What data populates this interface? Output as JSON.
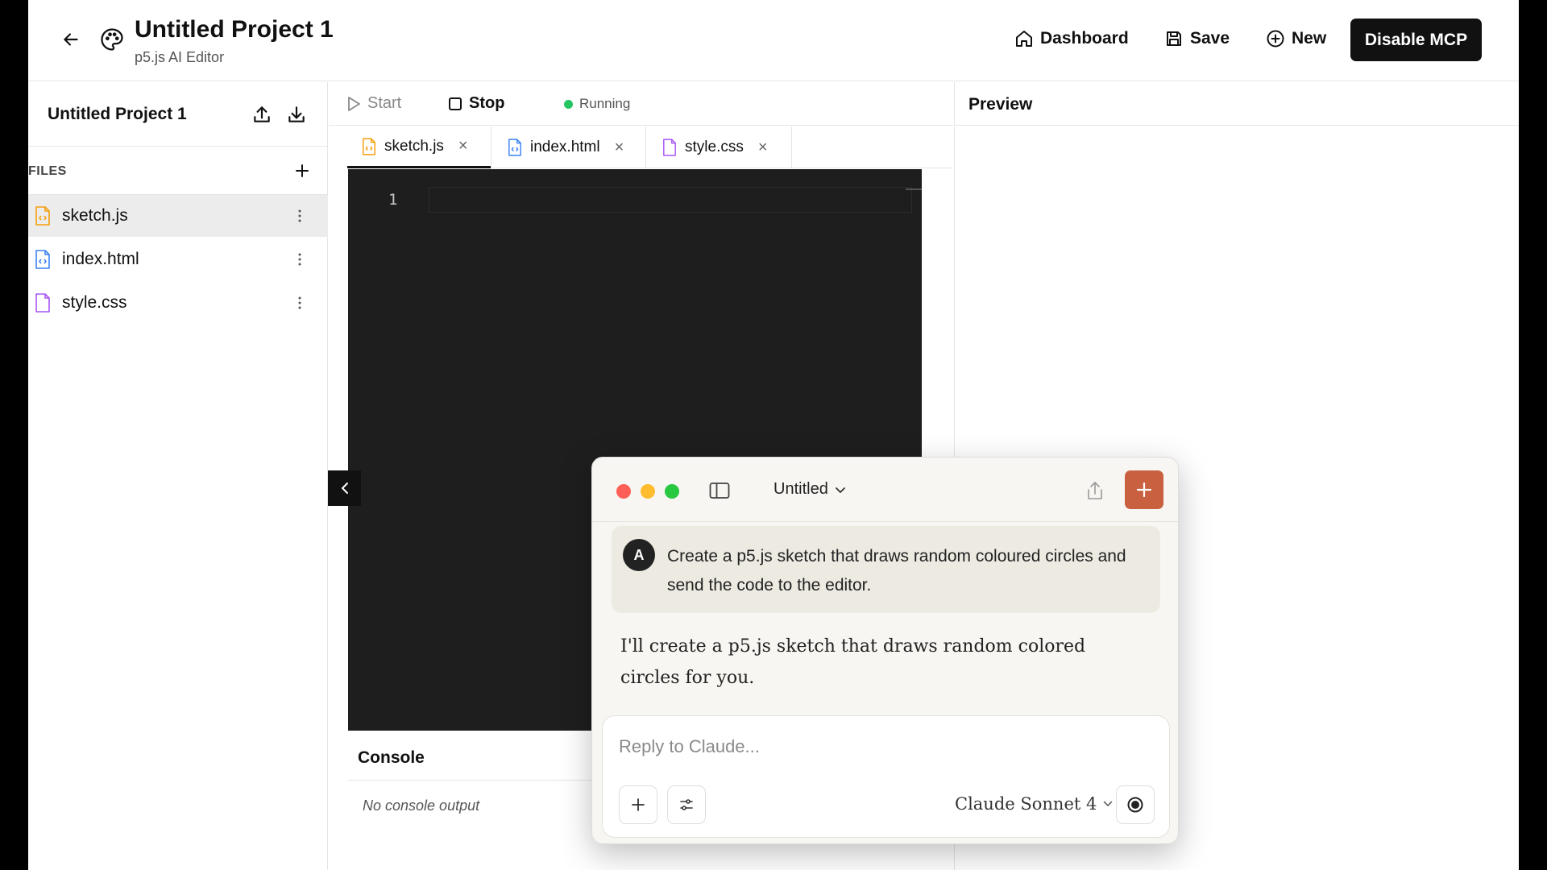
{
  "header": {
    "project_title": "Untitled Project 1",
    "subtitle": "p5.js AI Editor",
    "dashboard_label": "Dashboard",
    "save_label": "Save",
    "new_label": "New",
    "mcp_label": "Disable MCP"
  },
  "sidebar": {
    "title": "Untitled Project 1",
    "files_label": "FILES",
    "files": [
      {
        "name": "sketch.js",
        "icon": "js-file-icon",
        "color": "#f59e0b",
        "active": true
      },
      {
        "name": "index.html",
        "icon": "html-file-icon",
        "color": "#3b82f6",
        "active": false
      },
      {
        "name": "style.css",
        "icon": "css-file-icon",
        "color": "#a855f7",
        "active": false
      }
    ]
  },
  "toolbar": {
    "start_label": "Start",
    "stop_label": "Stop",
    "status_label": "Running",
    "status_color": "#22c55e"
  },
  "tabs": [
    {
      "name": "sketch.js",
      "close": "×"
    },
    {
      "name": "index.html",
      "close": "×"
    },
    {
      "name": "style.css",
      "close": "×"
    }
  ],
  "editor": {
    "line_numbers": [
      "1"
    ],
    "background": "#1e1e1e"
  },
  "console": {
    "title": "Console",
    "output": "No console output"
  },
  "preview": {
    "title": "Preview"
  },
  "claude_window": {
    "title": "Untitled",
    "user_avatar": "A",
    "user_message": "Create a p5.js sketch that draws random coloured circles and send the code to the editor.",
    "assistant_message": "I'll create a p5.js sketch that draws random colored circles for you.",
    "input_placeholder": "Reply to Claude...",
    "model_label": "Claude Sonnet 4",
    "accent_color": "#c9603f"
  }
}
